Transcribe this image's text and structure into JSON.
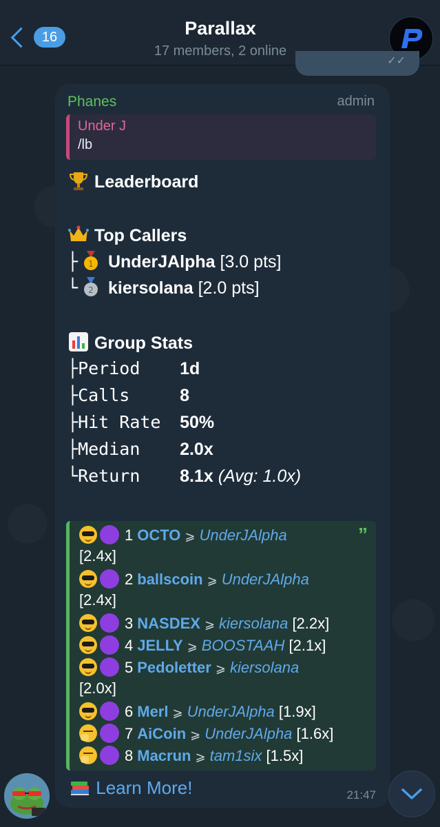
{
  "header": {
    "back_count": "16",
    "title": "Parallax",
    "subtitle": "17 members, 2 online"
  },
  "message": {
    "sender": "Phanes",
    "role": "admin",
    "reply": {
      "name": "Under J",
      "text": "/lb"
    },
    "leaderboard_title": "Leaderboard",
    "top_callers_title": "Top Callers",
    "callers": [
      {
        "prefix": "├",
        "name": "UnderJAlpha",
        "pts": "[3.0 pts]"
      },
      {
        "prefix": "└",
        "name": "kiersolana",
        "pts": "[2.0 pts]"
      }
    ],
    "group_stats_title": "Group Stats",
    "stats": [
      {
        "prefix": "├",
        "label": "Period",
        "value": "1d",
        "extra": ""
      },
      {
        "prefix": "├",
        "label": "Calls",
        "value": "8",
        "extra": ""
      },
      {
        "prefix": "├",
        "label": "Hit Rate",
        "value": "50%",
        "extra": ""
      },
      {
        "prefix": "├",
        "label": "Median",
        "value": "2.0x",
        "extra": ""
      },
      {
        "prefix": "└",
        "label": "Return",
        "value": "8.1x",
        "extra": "(Avg: 1.0x)"
      }
    ],
    "calls": [
      {
        "rank": "1",
        "token": "OCTO",
        "caller": "UnderJAlpha",
        "mult": "[2.4x]",
        "emoji": "sunglasses-face-icon"
      },
      {
        "rank": "2",
        "token": "ballscoin",
        "caller": "UnderJAlpha",
        "mult": "[2.4x]",
        "emoji": "sunglasses-face-icon"
      },
      {
        "rank": "3",
        "token": "NASDEX",
        "caller": "kiersolana",
        "mult": "[2.2x]",
        "emoji": "sunglasses-face-icon"
      },
      {
        "rank": "4",
        "token": "JELLY",
        "caller": "BOOSTAAH",
        "mult": "[2.1x]",
        "emoji": "sunglasses-face-icon"
      },
      {
        "rank": "5",
        "token": "Pedoletter",
        "caller": "kiersolana",
        "mult": "[2.0x]",
        "emoji": "sunglasses-face-icon"
      },
      {
        "rank": "6",
        "token": "Merl",
        "caller": "UnderJAlpha",
        "mult": "[1.9x]",
        "emoji": "sunglasses-face-icon"
      },
      {
        "rank": "7",
        "token": "AiCoin",
        "caller": "UnderJAlpha",
        "mult": "[1.6x]",
        "emoji": "yawning-face-icon"
      },
      {
        "rank": "8",
        "token": "Macrun",
        "caller": "tam1six",
        "mult": "[1.5x]",
        "emoji": "yawning-face-icon"
      }
    ],
    "link_text": "Learn More!",
    "time": "21:47"
  },
  "colors": {
    "accent": "#4a9de4",
    "sender": "#5cc35c",
    "reply_bar": "#c7497a",
    "quote_bar": "#55b65f"
  }
}
